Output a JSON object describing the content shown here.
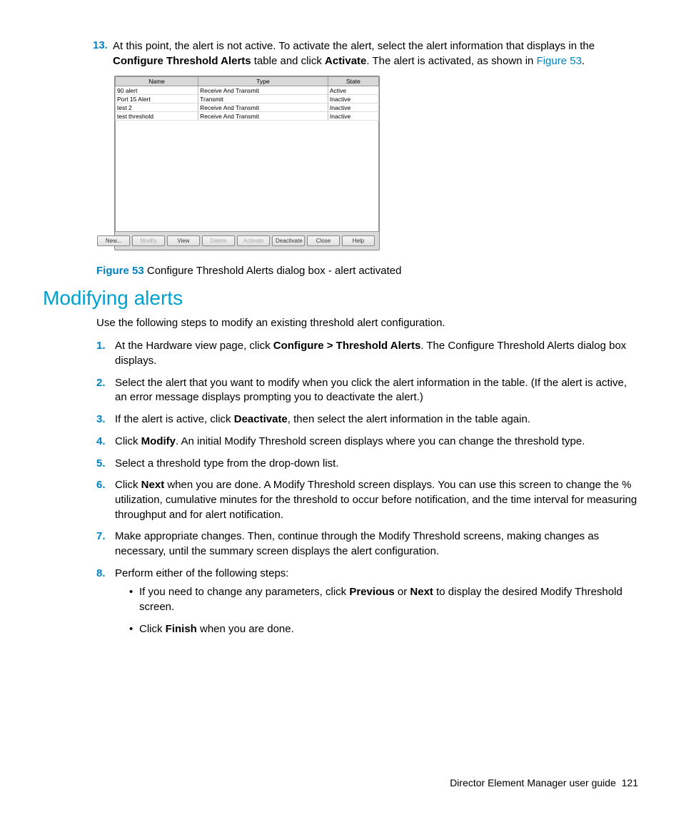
{
  "step13": {
    "num": "13.",
    "pre": "At this point, the alert is not active. To activate the alert, select the alert information that displays in the ",
    "bold1": "Configure Threshold Alerts",
    "mid": " table and click ",
    "bold2": "Activate",
    "post": ". The alert is activated, as shown in ",
    "link": "Figure 53",
    "end": "."
  },
  "dialog": {
    "headers": [
      "Name",
      "Type",
      "State"
    ],
    "rows": [
      {
        "name": "90 alert",
        "type": "Receive And Transmit",
        "state": "Active"
      },
      {
        "name": "Port 15 Alert",
        "type": "Transmit",
        "state": "Inactive"
      },
      {
        "name": "test 2",
        "type": "Receive And Transmit",
        "state": "Inactive"
      },
      {
        "name": "test threshold",
        "type": "Receive And Transmit",
        "state": "Inactive"
      }
    ],
    "buttons": [
      {
        "label": "New...",
        "dis": false
      },
      {
        "label": "Modify",
        "dis": true
      },
      {
        "label": "View",
        "dis": false
      },
      {
        "label": "Delete",
        "dis": true
      },
      {
        "label": "Activate",
        "dis": true
      },
      {
        "label": "Deactivate",
        "dis": false
      },
      {
        "label": "Close",
        "dis": false
      },
      {
        "label": "Help",
        "dis": false
      }
    ]
  },
  "figure": {
    "label": "Figure 53",
    "caption": " Configure Threshold Alerts dialog box - alert activated"
  },
  "sectionTitle": "Modifying alerts",
  "intro": "Use the following steps to modify an existing threshold alert configuration.",
  "steps": [
    {
      "n": "1.",
      "parts": [
        {
          "t": "At the Hardware view page, click "
        },
        {
          "t": "Configure > Threshold Alerts",
          "b": true
        },
        {
          "t": ". The Configure Threshold Alerts dialog box displays."
        }
      ]
    },
    {
      "n": "2.",
      "parts": [
        {
          "t": "Select the alert that you want to modify when you click the alert information in the table. (If the alert is active, an error message displays prompting you to deactivate the alert.)"
        }
      ]
    },
    {
      "n": "3.",
      "parts": [
        {
          "t": "If the alert is active, click "
        },
        {
          "t": "Deactivate",
          "b": true
        },
        {
          "t": ", then select the alert information in the table again."
        }
      ]
    },
    {
      "n": "4.",
      "parts": [
        {
          "t": "Click "
        },
        {
          "t": "Modify",
          "b": true
        },
        {
          "t": ". An initial Modify Threshold screen displays where you can change the threshold type."
        }
      ]
    },
    {
      "n": "5.",
      "parts": [
        {
          "t": "Select a threshold type from the drop-down list."
        }
      ]
    },
    {
      "n": "6.",
      "parts": [
        {
          "t": "Click "
        },
        {
          "t": "Next",
          "b": true
        },
        {
          "t": " when you are done. A Modify Threshold screen displays. You can use this screen to change the % utilization, cumulative minutes for the threshold to occur before notification, and the time interval for measuring throughput and for alert notification."
        }
      ]
    },
    {
      "n": "7.",
      "parts": [
        {
          "t": "Make appropriate changes. Then, continue through the Modify Threshold screens, making changes as necessary, until the summary screen displays the alert configuration."
        }
      ]
    },
    {
      "n": "8.",
      "parts": [
        {
          "t": "Perform either of the following steps:"
        }
      ],
      "sub": [
        {
          "parts": [
            {
              "t": "If you need to change any parameters, click "
            },
            {
              "t": "Previous",
              "b": true
            },
            {
              "t": " or "
            },
            {
              "t": "Next",
              "b": true
            },
            {
              "t": " to display the desired Modify Threshold screen."
            }
          ]
        },
        {
          "parts": [
            {
              "t": "Click "
            },
            {
              "t": "Finish",
              "b": true
            },
            {
              "t": " when you are done."
            }
          ]
        }
      ]
    }
  ],
  "footer": {
    "title": "Director Element Manager user guide",
    "page": "121"
  }
}
